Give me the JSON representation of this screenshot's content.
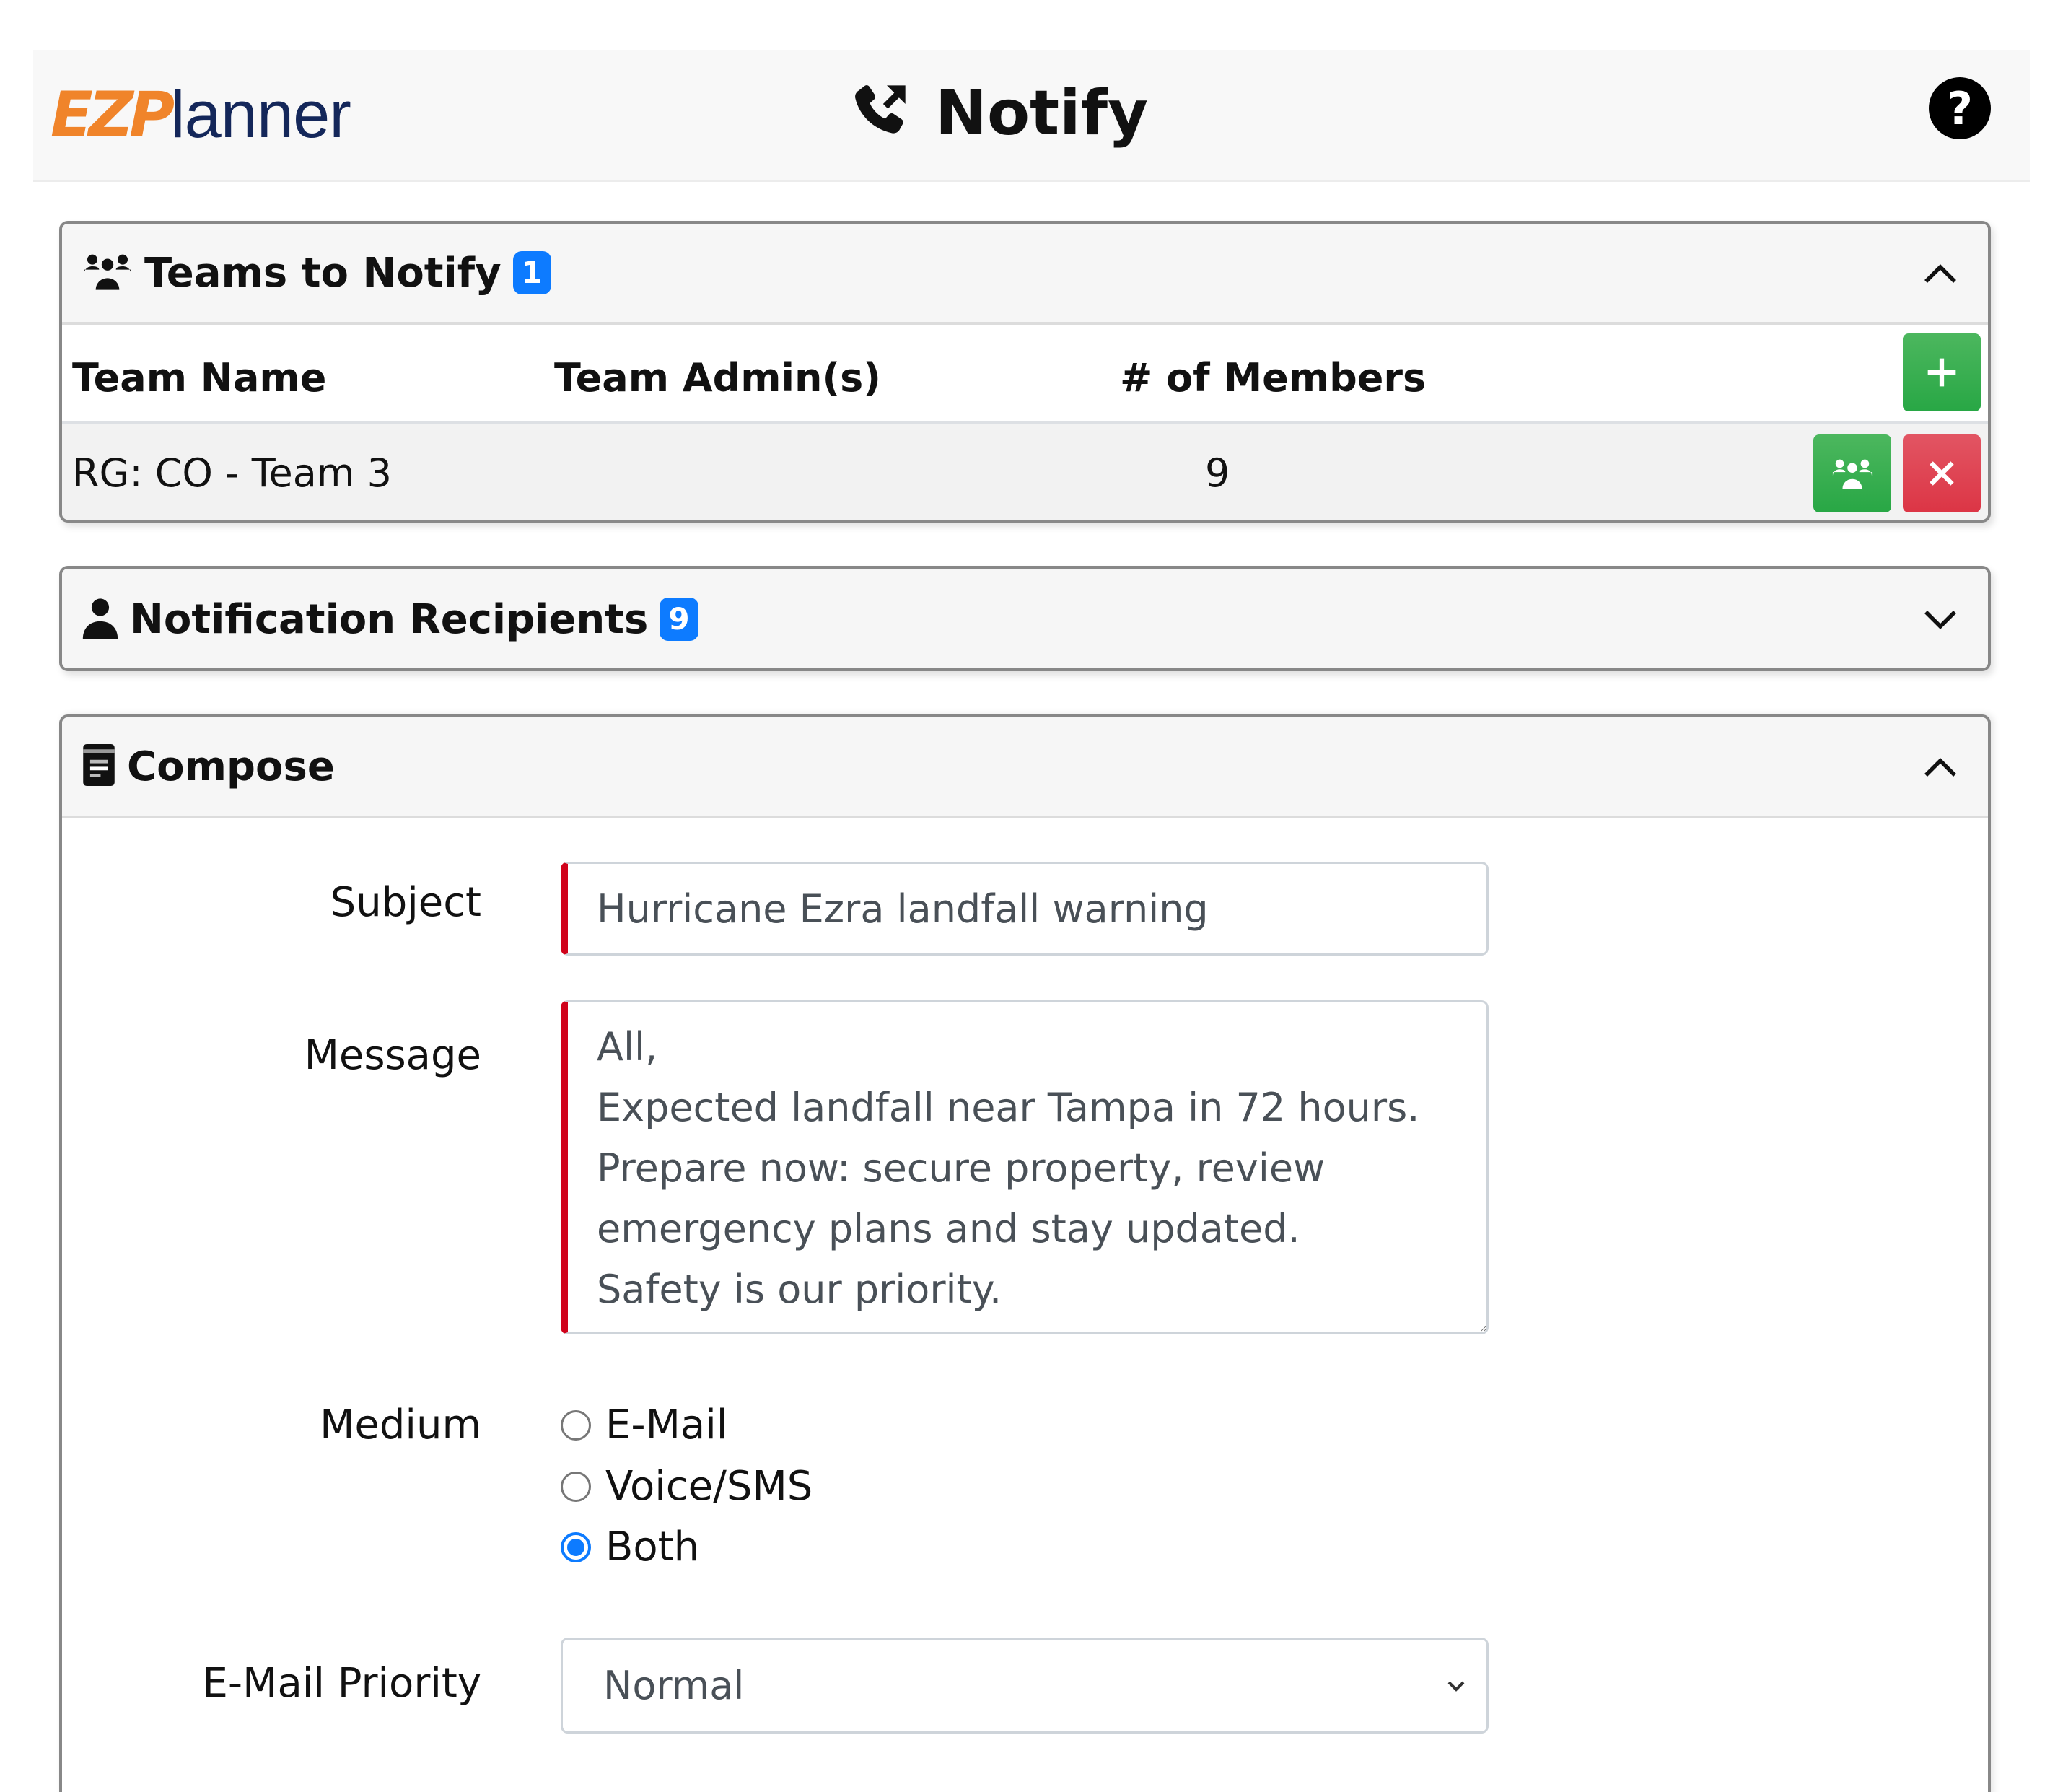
{
  "header": {
    "logo_ez": "EZP",
    "logo_rest": "lanner",
    "title": "Notify",
    "title_icon": "phone-outgoing-icon",
    "help_icon": "question-circle-icon",
    "help_glyph": "?"
  },
  "teams_panel": {
    "title": "Teams to Notify",
    "badge": "1",
    "icon": "users-icon",
    "expanded": true,
    "columns": [
      "Team Name",
      "Team Admin(s)",
      "# of Members"
    ],
    "add_button_icon": "plus-icon",
    "rows": [
      {
        "team_name": "RG: CO - Team 3",
        "team_admins": "",
        "members": "9",
        "view_members_icon": "users-icon",
        "remove_icon": "close-icon"
      }
    ]
  },
  "recipients_panel": {
    "title": "Notification Recipients",
    "badge": "9",
    "icon": "user-icon",
    "expanded": false
  },
  "compose_panel": {
    "title": "Compose",
    "icon": "document-icon",
    "expanded": true,
    "subject_label": "Subject",
    "subject_value": "Hurricane Ezra landfall warning",
    "message_label": "Message",
    "message_value": "All,\nExpected landfall near Tampa in 72 hours.\nPrepare now: secure property, review\nemergency plans and stay updated.\nSafety is our priority.",
    "medium_label": "Medium",
    "medium_options": [
      {
        "label": "E-Mail",
        "checked": false
      },
      {
        "label": "Voice/SMS",
        "checked": false
      },
      {
        "label": "Both",
        "checked": true
      }
    ],
    "priority_label": "E-Mail Priority",
    "priority_value": "Normal"
  },
  "colors": {
    "logo_orange": "#f0842a",
    "logo_navy": "#14275a",
    "badge_blue": "#0d7bff",
    "success_green": "#28a745",
    "danger_red": "#dc3545",
    "required_red": "#d0021b"
  }
}
